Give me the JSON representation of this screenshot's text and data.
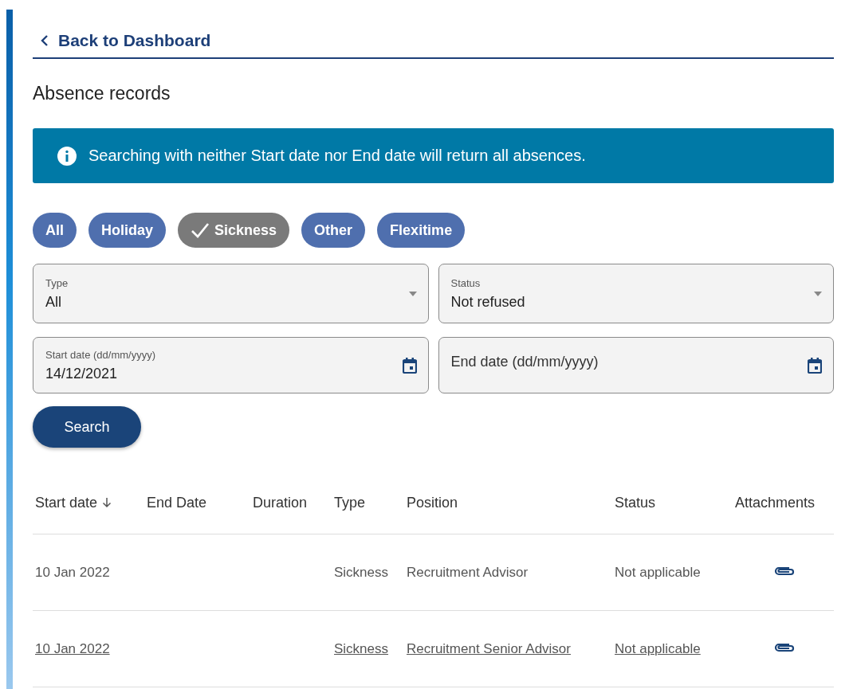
{
  "back_link": {
    "label": "Back to Dashboard"
  },
  "title": "Absence records",
  "info_banner": {
    "text": "Searching with neither Start date nor End date will return all absences."
  },
  "filter_chips": [
    {
      "label": "All",
      "selected": false
    },
    {
      "label": "Holiday",
      "selected": false
    },
    {
      "label": "Sickness",
      "selected": true
    },
    {
      "label": "Other",
      "selected": false
    },
    {
      "label": "Flexitime",
      "selected": false
    }
  ],
  "fields": [
    {
      "kind": "select",
      "label": "Type",
      "value": "All"
    },
    {
      "kind": "select",
      "label": "Status",
      "value": "Not refused"
    },
    {
      "kind": "date",
      "label": "Start date (dd/mm/yyyy)",
      "value": "14/12/2021"
    },
    {
      "kind": "date",
      "placeholder": "End date (dd/mm/yyyy)"
    }
  ],
  "search_button": {
    "label": "Search"
  },
  "table": {
    "columns": [
      {
        "label": "Start date",
        "sorted": true
      },
      {
        "label": "End Date",
        "sorted": false
      },
      {
        "label": "Duration",
        "sorted": false
      },
      {
        "label": "Type",
        "sorted": false
      },
      {
        "label": "Position",
        "sorted": false
      },
      {
        "label": "Status",
        "sorted": false
      },
      {
        "label": "Attachments",
        "sorted": false
      }
    ],
    "rows": [
      {
        "start_date": "10 Jan 2022",
        "type": "Sickness",
        "position": "Recruitment Advisor",
        "status": "Not applicable",
        "attachment": true,
        "hovered": false
      },
      {
        "start_date": "10 Jan 2022",
        "type": "Sickness",
        "position": "Recruitment Senior Advisor",
        "status": "Not applicable",
        "attachment": true,
        "hovered": true
      }
    ]
  }
}
